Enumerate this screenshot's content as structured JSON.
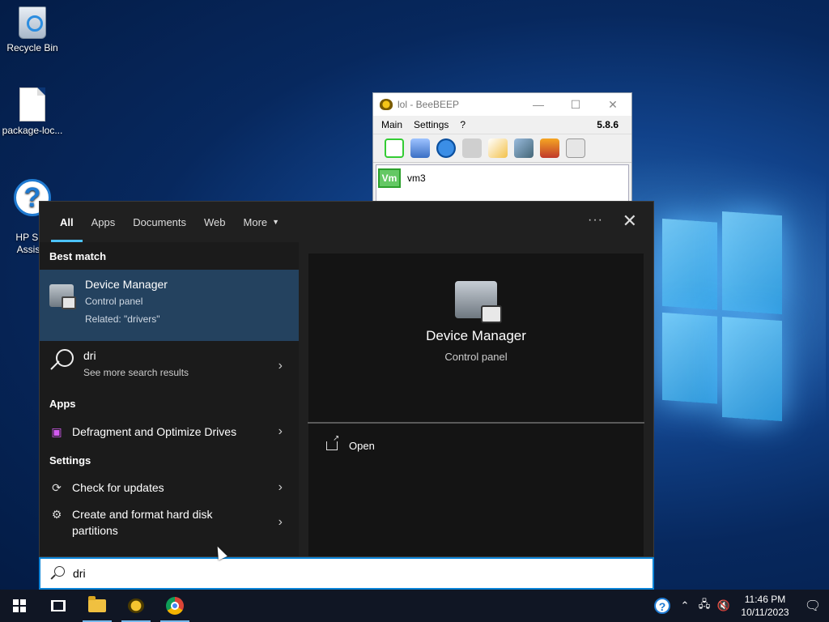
{
  "desktop": {
    "icons": [
      {
        "label": "Recycle Bin",
        "icon": "recycle-bin-icon"
      },
      {
        "label": "package-loc...",
        "icon": "file-icon"
      },
      {
        "label": "HP Sup\nAssista",
        "icon": "help-icon"
      }
    ]
  },
  "beebeep": {
    "title": "lol - BeeBEEP",
    "menu": [
      "Main",
      "Settings",
      "?"
    ],
    "version": "5.8.6",
    "users": [
      {
        "initials": "Vm",
        "name": "vm3"
      }
    ]
  },
  "search_panel": {
    "tabs": [
      "All",
      "Apps",
      "Documents",
      "Web",
      "More"
    ],
    "active_tab": "All",
    "dots": "···",
    "close": "✕",
    "best_match": {
      "section": "Best match",
      "title": "Device Manager",
      "subtitle": "Control panel",
      "related": "Related: \"drivers\""
    },
    "web_search": {
      "query": "dri",
      "sub": "See more search results"
    },
    "apps_section": "Apps",
    "apps": [
      {
        "label": "Defragment and Optimize Drives"
      }
    ],
    "settings_section": "Settings",
    "settings": [
      {
        "label": "Check for updates"
      },
      {
        "label": "Create and format hard disk partitions"
      }
    ],
    "preview": {
      "title": "Device Manager",
      "subtitle": "Control panel",
      "open_label": "Open"
    }
  },
  "search_box": {
    "value": "dri"
  },
  "taskbar": {
    "pinned": [
      "windows-start-icon",
      "task-view-icon",
      "file-explorer-icon",
      "beebeep-icon",
      "chrome-icon"
    ],
    "tray_icons": [
      "help-icon",
      "chevron-up-icon",
      "network-icon",
      "volume-muted-icon"
    ],
    "time": "11:46 PM",
    "date": "10/11/2023"
  }
}
